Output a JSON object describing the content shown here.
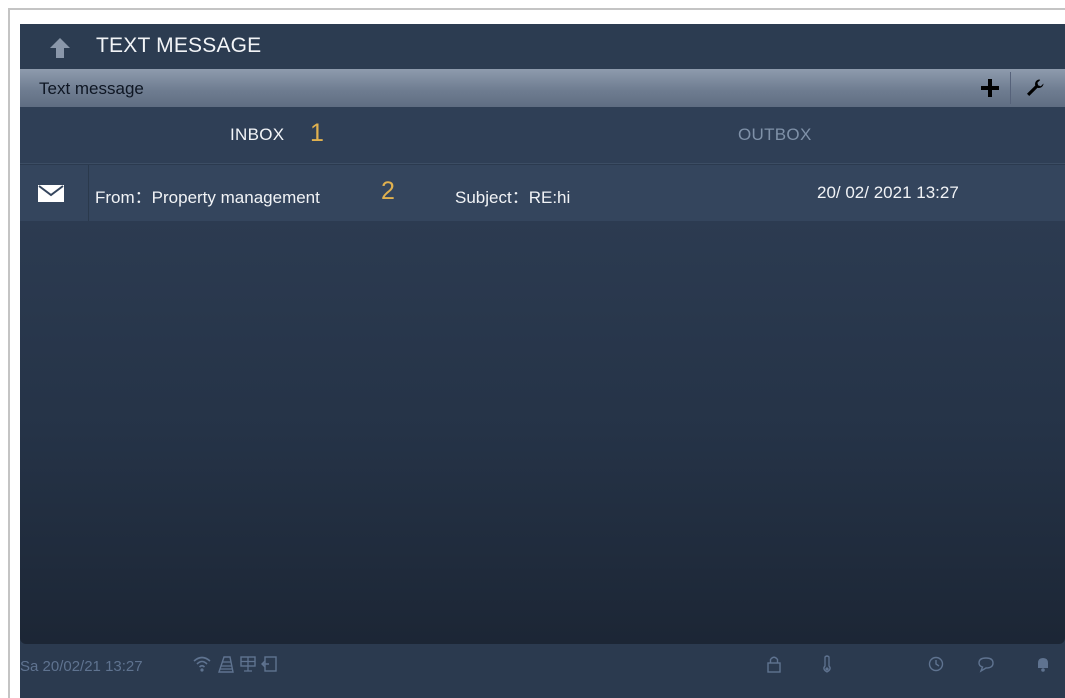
{
  "header": {
    "title": "TEXT MESSAGE",
    "back_icon": "back-arrow-icon"
  },
  "subheader": {
    "title": "Text message",
    "add_icon": "plus-icon",
    "settings_icon": "wrench-icon"
  },
  "tabs": [
    {
      "label": "INBOX",
      "callout": "1",
      "active": true
    },
    {
      "label": "OUTBOX",
      "active": false
    }
  ],
  "messages": [
    {
      "icon": "envelope-icon",
      "from": "From：Property management",
      "callout": "2",
      "subject": "Subject：RE:hi",
      "datetime": "20/ 02/ 2021 13:27"
    }
  ],
  "status_bar": {
    "datetime": "Sa 20/02/21  13:27",
    "left_icons": [
      "wifi-icon",
      "building-icon",
      "monitor-icon",
      "door-icon"
    ],
    "right_icons": [
      "lock-icon",
      "thermometer-icon",
      "history-icon",
      "chat-icon",
      "bell-icon"
    ]
  },
  "colors": {
    "background": "#2b3a4f",
    "callout": "#e0b14f",
    "inactive_tab": "#7f91a8",
    "status_text": "#5f7390"
  }
}
